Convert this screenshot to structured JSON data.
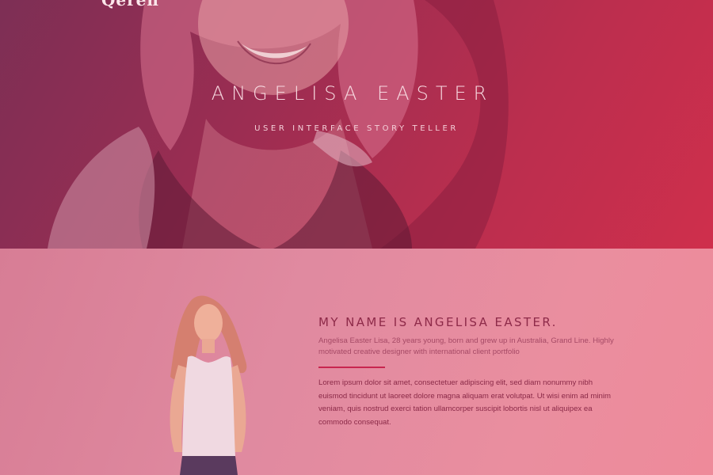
{
  "hero": {
    "logo_text": "Qeren",
    "title": "ANGELISA EASTER",
    "subtitle": "USER INTERFACE STORY TELLER"
  },
  "about": {
    "heading": "MY NAME IS ANGELISA EASTER.",
    "intro": "Angelisa Easter Lisa, 28 years young, born and grew up in Australia, Grand Line. Highly motivated creative designer with international client portfolio",
    "body": "Lorem ipsum dolor sit amet, consectetuer adipiscing elit, sed diam nonummy nibh euismod tincidunt ut laoreet dolore magna aliquam erat volutpat. Ut wisi enim ad minim veniam, quis nostrud exerci tation ullamcorper suscipit lobortis nisl ut aliquipex ea commodo consequat."
  },
  "colors": {
    "hero_overlay_start": "#7d2f55",
    "hero_overlay_end": "#cf2f4c",
    "about_bg": "#e68fa0",
    "heading_color": "#8e2a49",
    "divider_accent": "#c8264f"
  }
}
